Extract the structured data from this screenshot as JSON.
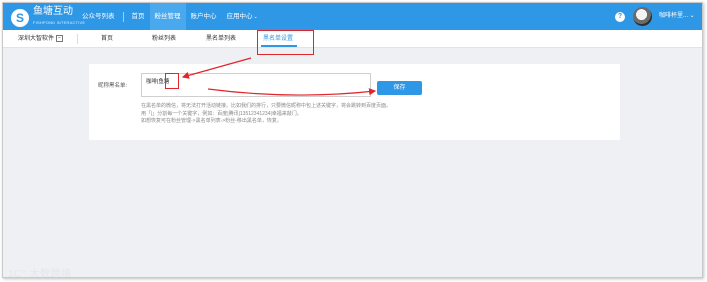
{
  "brand": {
    "logo_glyph": "S",
    "name": "鱼塘互动",
    "sub": "FISHPOND INTERACTIVE"
  },
  "nav": {
    "items": [
      {
        "label": "公众号列表",
        "active": false
      },
      {
        "label": "首页",
        "active": false
      },
      {
        "label": "粉丝管理",
        "active": true
      },
      {
        "label": "账户中心",
        "active": false
      },
      {
        "label": "应用中心",
        "active": false,
        "caret": "⌄"
      }
    ],
    "help_glyph": "?",
    "user_label": "咖啡杯里... ⌄"
  },
  "subbar": {
    "org_label": "深圳大智软件",
    "org_expand_glyph": "−",
    "tabs": [
      "首页",
      "粉丝列表",
      "黑名单列表",
      "黑名单设置"
    ],
    "active_tab": "黑名单设置"
  },
  "form": {
    "label": "昵称黑名单:",
    "value": "咖啡|鱼塘",
    "save_label": "保存",
    "hints": [
      "在黑名单的微信，将无法打开活动链接。比如我们的排行，只要微信昵称中包上述关键字，将会跳转到百度页面。",
      "用「|」分割每一个关键字，例如：百度|腾讯|13512341234|幸福来敲门。",
      "如想恢复可在粉丝管理->黑名单列表->粉丝-移出黑名单，恢复。"
    ]
  },
  "watermark": "1C° 大数跨境",
  "colors": {
    "primary": "#2e97e6",
    "highlight": "#e0252b"
  }
}
